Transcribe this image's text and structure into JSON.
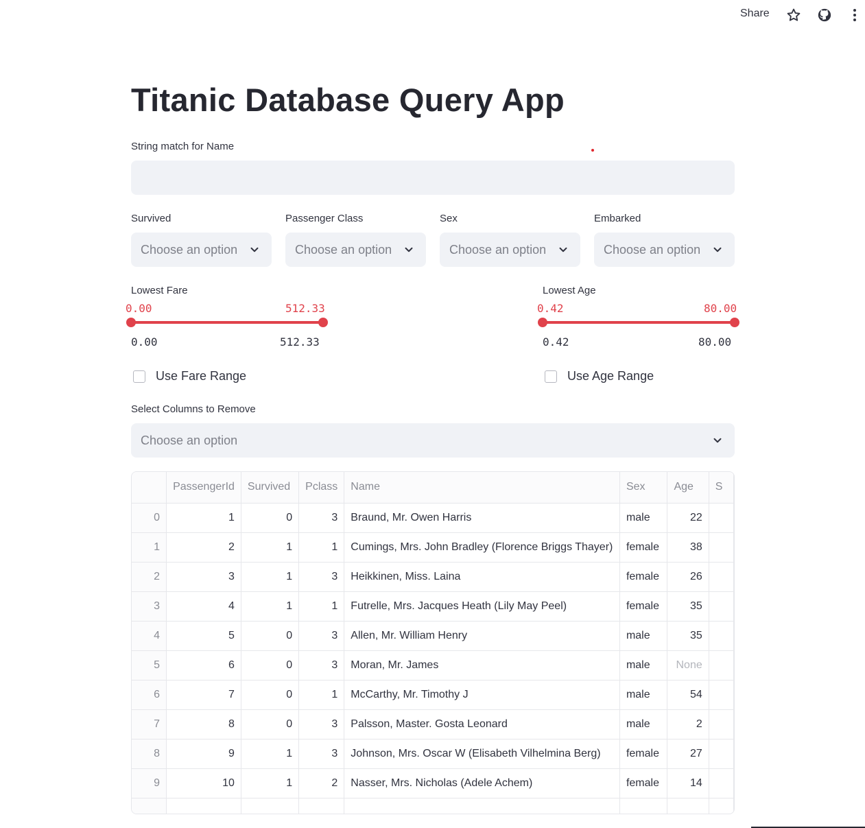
{
  "header": {
    "share_label": "Share",
    "icons": [
      "star-icon",
      "github-icon",
      "more-vertical-icon"
    ]
  },
  "title": "Titanic Database Query App",
  "name_filter": {
    "label": "String match for Name",
    "value": ""
  },
  "filters": [
    {
      "label": "Survived",
      "placeholder": "Choose an option"
    },
    {
      "label": "Passenger Class",
      "placeholder": "Choose an option"
    },
    {
      "label": "Sex",
      "placeholder": "Choose an option"
    },
    {
      "label": "Embarked",
      "placeholder": "Choose an option"
    }
  ],
  "fare_slider": {
    "label": "Lowest Fare",
    "low_value": "0.00",
    "high_value": "512.33",
    "min_label": "0.00",
    "max_label": "512.33",
    "low_fraction": 0.0,
    "high_fraction": 1.0
  },
  "age_slider": {
    "label": "Lowest Age",
    "low_value": "0.42",
    "high_value": "80.00",
    "min_label": "0.42",
    "max_label": "80.00",
    "low_fraction": 0.0,
    "high_fraction": 1.0
  },
  "checkboxes": {
    "fare": {
      "label": "Use Fare Range",
      "checked": false
    },
    "age": {
      "label": "Use Age Range",
      "checked": false
    }
  },
  "remove_columns": {
    "label": "Select Columns to Remove",
    "placeholder": "Choose an option"
  },
  "table": {
    "columns": [
      "",
      "PassengerId",
      "Survived",
      "Pclass",
      "Name",
      "Sex",
      "Age",
      "S"
    ],
    "rows": [
      [
        "0",
        "1",
        "0",
        "3",
        "Braund, Mr. Owen Harris",
        "male",
        "22"
      ],
      [
        "1",
        "2",
        "1",
        "1",
        "Cumings, Mrs. John Bradley (Florence Briggs Thayer)",
        "female",
        "38"
      ],
      [
        "2",
        "3",
        "1",
        "3",
        "Heikkinen, Miss. Laina",
        "female",
        "26"
      ],
      [
        "3",
        "4",
        "1",
        "1",
        "Futrelle, Mrs. Jacques Heath (Lily May Peel)",
        "female",
        "35"
      ],
      [
        "4",
        "5",
        "0",
        "3",
        "Allen, Mr. William Henry",
        "male",
        "35"
      ],
      [
        "5",
        "6",
        "0",
        "3",
        "Moran, Mr. James",
        "male",
        "None"
      ],
      [
        "6",
        "7",
        "0",
        "1",
        "McCarthy, Mr. Timothy J",
        "male",
        "54"
      ],
      [
        "7",
        "8",
        "0",
        "3",
        "Palsson, Master. Gosta Leonard",
        "male",
        "2"
      ],
      [
        "8",
        "9",
        "1",
        "3",
        "Johnson, Mrs. Oscar W (Elisabeth Vilhelmina Berg)",
        "female",
        "27"
      ],
      [
        "9",
        "10",
        "1",
        "2",
        "Nasser, Mrs. Nicholas (Adele Achem)",
        "female",
        "14"
      ]
    ]
  },
  "colors": {
    "accent": "#e0424b",
    "input_bg": "#f0f2f6",
    "text": "#31333f"
  }
}
